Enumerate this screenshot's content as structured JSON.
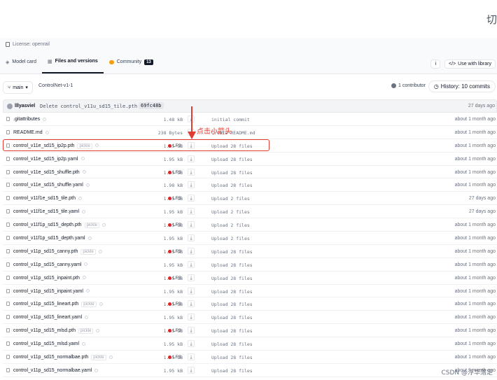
{
  "corner_char": "切",
  "license": "License: openrail",
  "tabs": [
    {
      "label": "Model card"
    },
    {
      "label": "Files and versions"
    },
    {
      "label": "Community",
      "badge": "13"
    }
  ],
  "header_buttons": {
    "info": "i",
    "use_with_library": "Use with library"
  },
  "branch": {
    "label": "main"
  },
  "breadcrumb": "ControlNet-v1-1",
  "contributors": "1 contributor",
  "history": "History: 10 commits",
  "last_commit": {
    "user": "lllyasviel",
    "message": "Delete control_v11u_sd15_tile.pth",
    "hash": "69fc48b",
    "date": "27 days ago"
  },
  "annotation": "点击小箭头",
  "watermark": "CSDN @浮华落定",
  "files": [
    {
      "name": ".gitattributes",
      "size": "1.48 kB",
      "lfs": "",
      "pickle": "",
      "message": "initial commit",
      "date": "about 1 month ago"
    },
    {
      "name": "README.md",
      "size": "238 Bytes",
      "lfs": "",
      "pickle": "",
      "message": "Create README.md",
      "date": "about 1 month ago"
    },
    {
      "name": "control_v11e_sd15_ip2p.pth",
      "size": "1.45 GB",
      "lfs": "LFS",
      "pickle": "pickle",
      "message": "Upload 28 files",
      "date": "about 1 month ago"
    },
    {
      "name": "control_v11e_sd15_ip2p.yaml",
      "size": "1.95 kB",
      "lfs": "",
      "pickle": "",
      "message": "Upload 28 files",
      "date": "about 1 month ago"
    },
    {
      "name": "control_v11e_sd15_shuffle.pth",
      "size": "1.45 GB",
      "lfs": "LFS",
      "pickle": "",
      "message": "Upload 28 files",
      "date": "about 1 month ago"
    },
    {
      "name": "control_v11e_sd15_shuffle.yaml",
      "size": "1.98 kB",
      "lfs": "",
      "pickle": "",
      "message": "Upload 28 files",
      "date": "about 1 month ago"
    },
    {
      "name": "control_v11f1e_sd15_tile.pth",
      "size": "1.45 GB",
      "lfs": "LFS",
      "pickle": "",
      "message": "Upload 2 files",
      "date": "27 days ago"
    },
    {
      "name": "control_v11f1e_sd15_tile.yaml",
      "size": "1.95 kB",
      "lfs": "",
      "pickle": "",
      "message": "Upload 2 files",
      "date": "27 days ago"
    },
    {
      "name": "control_v11f1p_sd15_depth.pth",
      "size": "1.45 GB",
      "lfs": "LFS",
      "pickle": "pickle",
      "message": "Upload 2 files",
      "date": "about 1 month ago"
    },
    {
      "name": "control_v11f1p_sd15_depth.yaml",
      "size": "1.95 kB",
      "lfs": "",
      "pickle": "",
      "message": "Upload 2 files",
      "date": "about 1 month ago"
    },
    {
      "name": "control_v11p_sd15_canny.pth",
      "size": "1.45 GB",
      "lfs": "LFS",
      "pickle": "pickle",
      "message": "Upload 28 files",
      "date": "about 1 month ago"
    },
    {
      "name": "control_v11p_sd15_canny.yaml",
      "size": "1.95 kB",
      "lfs": "",
      "pickle": "",
      "message": "Upload 28 files",
      "date": "about 1 month ago"
    },
    {
      "name": "control_v11p_sd15_inpaint.pth",
      "size": "1.45 GB",
      "lfs": "LFS",
      "pickle": "",
      "message": "Upload 28 files",
      "date": "about 1 month ago"
    },
    {
      "name": "control_v11p_sd15_inpaint.yaml",
      "size": "1.95 kB",
      "lfs": "",
      "pickle": "",
      "message": "Upload 28 files",
      "date": "about 1 month ago"
    },
    {
      "name": "control_v11p_sd15_lineart.pth",
      "size": "1.45 GB",
      "lfs": "LFS",
      "pickle": "pickle",
      "message": "Upload 28 files",
      "date": "about 1 month ago"
    },
    {
      "name": "control_v11p_sd15_lineart.yaml",
      "size": "1.95 kB",
      "lfs": "",
      "pickle": "",
      "message": "Upload 28 files",
      "date": "about 1 month ago"
    },
    {
      "name": "control_v11p_sd15_mlsd.pth",
      "size": "1.45 GB",
      "lfs": "LFS",
      "pickle": "pickle",
      "message": "Upload 28 files",
      "date": "about 1 month ago"
    },
    {
      "name": "control_v11p_sd15_mlsd.yaml",
      "size": "1.95 kB",
      "lfs": "",
      "pickle": "",
      "message": "Upload 28 files",
      "date": "about 1 month ago"
    },
    {
      "name": "control_v11p_sd15_normalbae.pth",
      "size": "1.45 GB",
      "lfs": "LFS",
      "pickle": "pickle",
      "message": "Upload 28 files",
      "date": "about 1 month ago"
    },
    {
      "name": "control_v11p_sd15_normalbae.yaml",
      "size": "1.95 kB",
      "lfs": "",
      "pickle": "",
      "message": "Upload 28 files",
      "date": "about 1 month ago"
    }
  ]
}
